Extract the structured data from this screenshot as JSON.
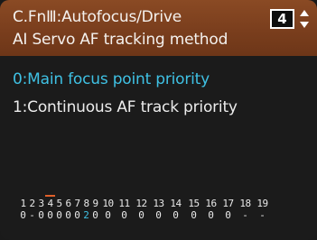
{
  "header": {
    "title": "C.FnⅢ:Autofocus/Drive",
    "subtitle": "AI Servo AF tracking method",
    "page_number": "4"
  },
  "options": [
    {
      "label": "0:Main focus point priority",
      "selected": true
    },
    {
      "label": "1:Continuous AF track priority",
      "selected": false
    }
  ],
  "legend": {
    "numbers": [
      "1",
      "2",
      "3",
      "4",
      "5",
      "6",
      "7",
      "8",
      "9",
      "10",
      "11",
      "12",
      "13",
      "14",
      "15",
      "16",
      "17",
      "18",
      "19"
    ],
    "values": [
      "0",
      "-",
      "0",
      "0",
      "0",
      "0",
      "0",
      "2",
      "0",
      "0",
      "0",
      "0",
      "0",
      "0",
      "0",
      "0",
      "0",
      "-",
      "-"
    ],
    "current_index": 3,
    "highlight_value_index": 7
  },
  "colors": {
    "header_bg": "#7a3e1d",
    "selected_text": "#3fc1e4",
    "marker": "#e0602a"
  }
}
